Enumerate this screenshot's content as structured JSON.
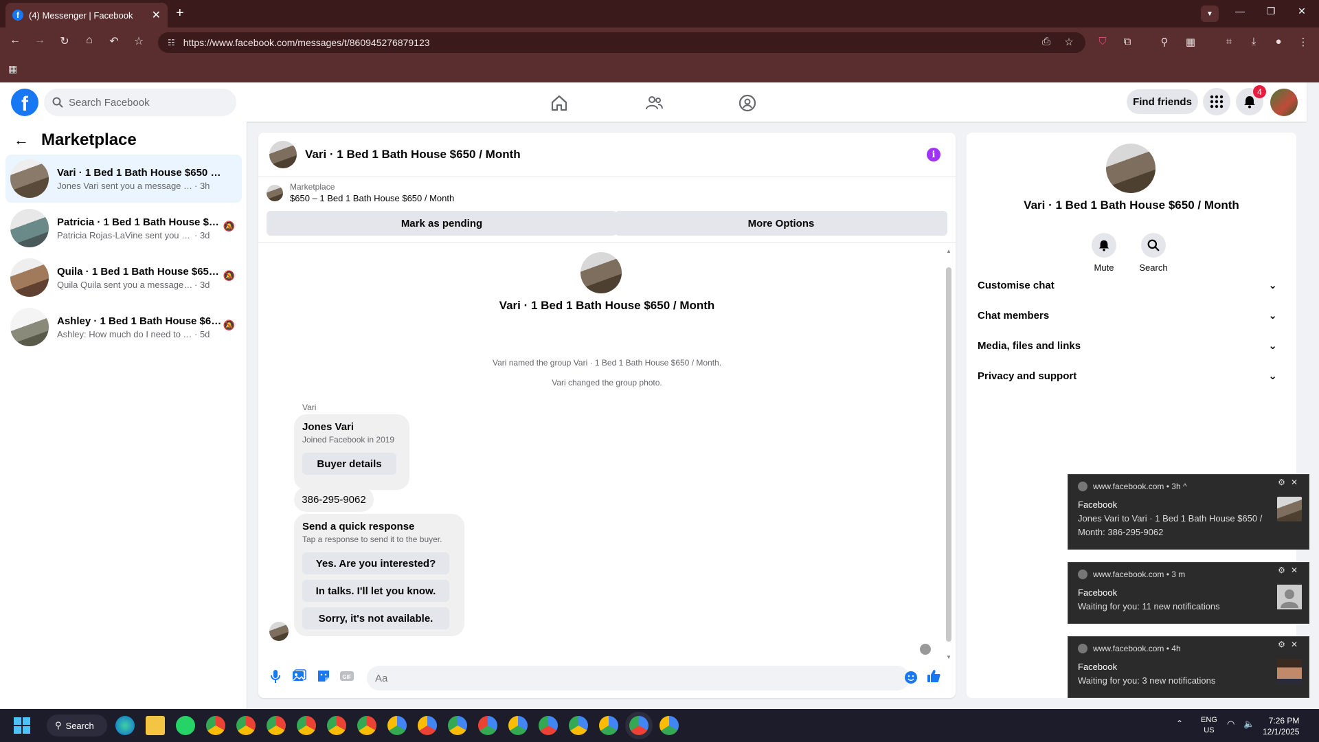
{
  "browser": {
    "tab_title": "(4) Messenger | Facebook",
    "url": "https://www.facebook.com/messages/t/860945276879123"
  },
  "fb": {
    "search_placeholder": "Search Facebook",
    "find_friends": "Find friends",
    "notification_count": "4"
  },
  "sidebar": {
    "title": "Marketplace",
    "conversations": [
      {
        "name": "Vari · 1 Bed 1 Bath House $650 / M...",
        "snippet": "Jones Vari sent you a message about ...",
        "time": "· 3h"
      },
      {
        "name": "Patricia · 1 Bed 1 Bath House $65...",
        "snippet": "Patricia Rojas-LaVine sent you a me...",
        "time": "· 3d"
      },
      {
        "name": "Quila · 1 Bed 1 Bath House $650 ...",
        "snippet": "Quila Quila sent you a message ab...",
        "time": "· 3d"
      },
      {
        "name": "Ashley · 1 Bed 1 Bath House $65...",
        "snippet": "Ashley: How much do I need to mo...",
        "time": "· 5d"
      }
    ]
  },
  "chat": {
    "title": "Vari · 1 Bed 1 Bath House $650 / Month",
    "listing_label": "Marketplace",
    "listing_desc": "$650 – 1 Bed 1 Bath House $650 / Month",
    "mark_pending": "Mark as pending",
    "more_options": "More Options",
    "group_name": "Vari · 1 Bed 1 Bath House $650 / Month",
    "system_msgs": [
      "Vari named the group Vari · 1 Bed 1 Bath House $650 / Month.",
      "Vari changed the group photo."
    ],
    "sender": "Vari",
    "buyer_name": "Jones Vari",
    "buyer_sub": "Joined Facebook in 2019",
    "buyer_details": "Buyer details",
    "phone": "386-295-9062",
    "quick_title": "Send a quick response",
    "quick_sub": "Tap a response to send it to the buyer.",
    "quick_replies": [
      "Yes. Are you interested?",
      "In talks. I'll let you know.",
      "Sorry, it's not available."
    ],
    "input_placeholder": "Aa"
  },
  "panel": {
    "title": "Vari · 1 Bed 1 Bath House $650 / Month",
    "mute": "Mute",
    "search": "Search",
    "sections": [
      "Customise chat",
      "Chat members",
      "Media, files and links",
      "Privacy and support"
    ]
  },
  "notifications": [
    {
      "origin": "www.facebook.com",
      "time": "• 3h ^",
      "title": "Facebook",
      "body": "Jones Vari to Vari · 1 Bed 1 Bath House $650 / Month: 386-295-9062"
    },
    {
      "origin": "www.facebook.com",
      "time": "• 3 m",
      "title": "Facebook",
      "body": "Waiting for you: 11 new notifications"
    },
    {
      "origin": "www.facebook.com",
      "time": "• 4h",
      "title": "Facebook",
      "body": "Waiting for you: 3 new notifications"
    }
  ],
  "taskbar": {
    "search": "Search",
    "lang1": "ENG",
    "lang2": "US",
    "time": "7:26 PM",
    "date": "12/1/2025"
  },
  "colors": {
    "fb_blue": "#1877f2",
    "badge_red": "#e41e3f",
    "info_purple": "#a033ff"
  }
}
